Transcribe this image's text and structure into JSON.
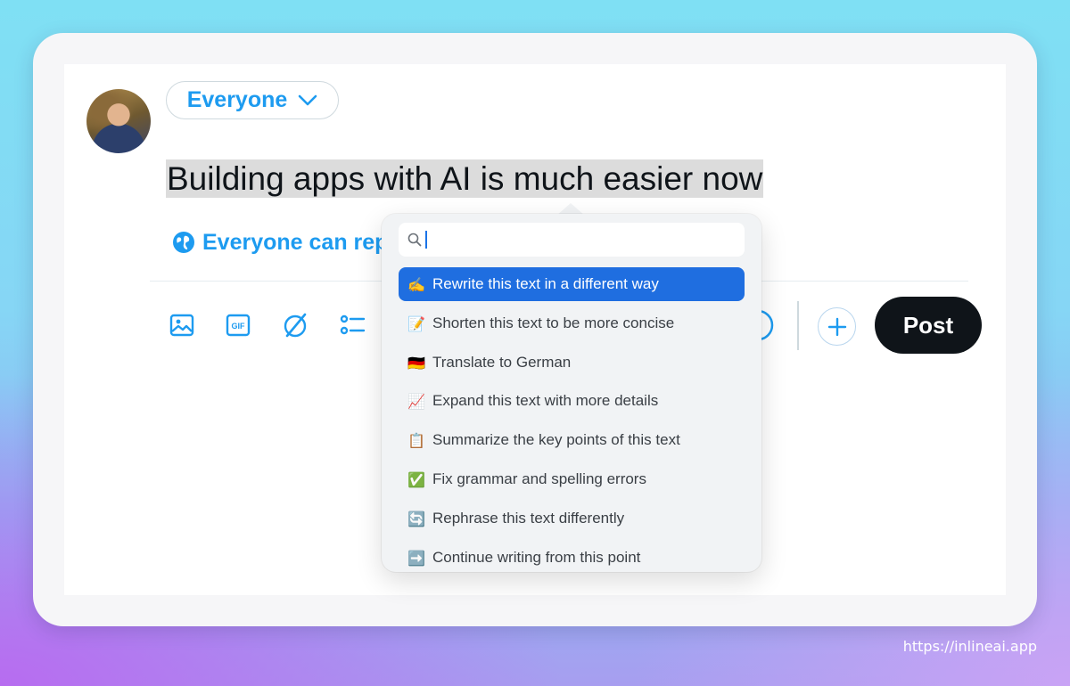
{
  "composer": {
    "audience_label": "Everyone",
    "text": "Building apps with AI is much easier now",
    "reply_setting": "Everyone can rep",
    "post_label": "Post"
  },
  "toolbar": {
    "icons": [
      "image-icon",
      "gif-icon",
      "grok-icon",
      "poll-icon",
      "progress-ring-icon",
      "add-icon"
    ]
  },
  "popup": {
    "search_value": "",
    "items": [
      {
        "emoji": "✍️",
        "label": "Rewrite this text in a different way",
        "active": true
      },
      {
        "emoji": "📝",
        "label": "Shorten this text to be more concise",
        "active": false
      },
      {
        "emoji": "🇩🇪",
        "label": "Translate to German",
        "active": false
      },
      {
        "emoji": "📈",
        "label": "Expand this text with more details",
        "active": false
      },
      {
        "emoji": "📋",
        "label": "Summarize the key points of this text",
        "active": false
      },
      {
        "emoji": "✅",
        "label": "Fix grammar and spelling errors",
        "active": false
      },
      {
        "emoji": "🔄",
        "label": "Rephrase this text differently",
        "active": false
      },
      {
        "emoji": "➡️",
        "label": "Continue writing from this point",
        "active": false
      }
    ]
  },
  "footer": {
    "url": "https://inlineai.app"
  },
  "colors": {
    "accent": "#1d9bf0",
    "selection": "#1f6ee0",
    "post_button": "#0f1419"
  }
}
